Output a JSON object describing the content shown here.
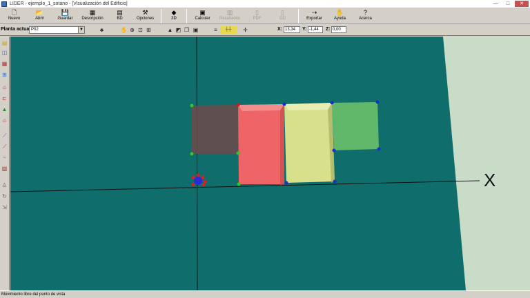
{
  "window": {
    "title": "LIDER - ejemplo_1_sotano - [Visualización del Edificio]",
    "minimize": "—",
    "maximize": "□",
    "close": "✕"
  },
  "toolbar": {
    "buttons": [
      {
        "label": "Nuevo",
        "icon": "new-file-icon",
        "glyph": "🗋",
        "enabled": true
      },
      {
        "label": "Abrir",
        "icon": "open-folder-icon",
        "glyph": "📂",
        "enabled": true
      },
      {
        "label": "Guardar",
        "icon": "save-disk-icon",
        "glyph": "💾",
        "enabled": true
      },
      {
        "label": "Descripción",
        "icon": "description-icon",
        "glyph": "▦",
        "enabled": true
      },
      {
        "label": "BD",
        "icon": "database-icon",
        "glyph": "▤",
        "enabled": true
      },
      {
        "label": "Opciones",
        "icon": "hammer-icon",
        "glyph": "⚒",
        "enabled": true
      },
      {
        "label": "3D",
        "icon": "3d-icon",
        "glyph": "◆",
        "enabled": true
      },
      {
        "label": "Calcular",
        "icon": "calculator-icon",
        "glyph": "▣",
        "enabled": true
      },
      {
        "label": "Resultados",
        "icon": "results-chart-icon",
        "glyph": "▥",
        "enabled": false
      },
      {
        "label": "PDF",
        "icon": "pdf-icon",
        "glyph": "▯",
        "enabled": false
      },
      {
        "label": "GD",
        "icon": "gd-icon",
        "glyph": "▯",
        "enabled": false
      },
      {
        "label": "Exportar",
        "icon": "export-icon",
        "glyph": "⇢",
        "enabled": true
      },
      {
        "label": "Ayuda",
        "icon": "help-icon",
        "glyph": "✋",
        "enabled": true
      },
      {
        "label": "Acerca",
        "icon": "about-icon",
        "glyph": "?",
        "enabled": true
      }
    ]
  },
  "planta": {
    "label": "Planta actual",
    "value": "P02"
  },
  "coords": {
    "x_label": "X:",
    "x_value": "13,34",
    "y_label": "Y:",
    "y_value": "-1,44",
    "z_label": "Z:",
    "z_value": "0,00"
  },
  "viewport": {
    "axis_label": "X",
    "colors": {
      "ground": "#0f6e6c",
      "sky": "#c8dcc8",
      "block_brown": "#6e4a4a",
      "block_red": "#ef6466",
      "block_yellow": "#d8e08c",
      "block_green": "#62b86a",
      "axis": "#111111"
    }
  },
  "status": {
    "text": "Movimiento libre del punto de vista"
  }
}
